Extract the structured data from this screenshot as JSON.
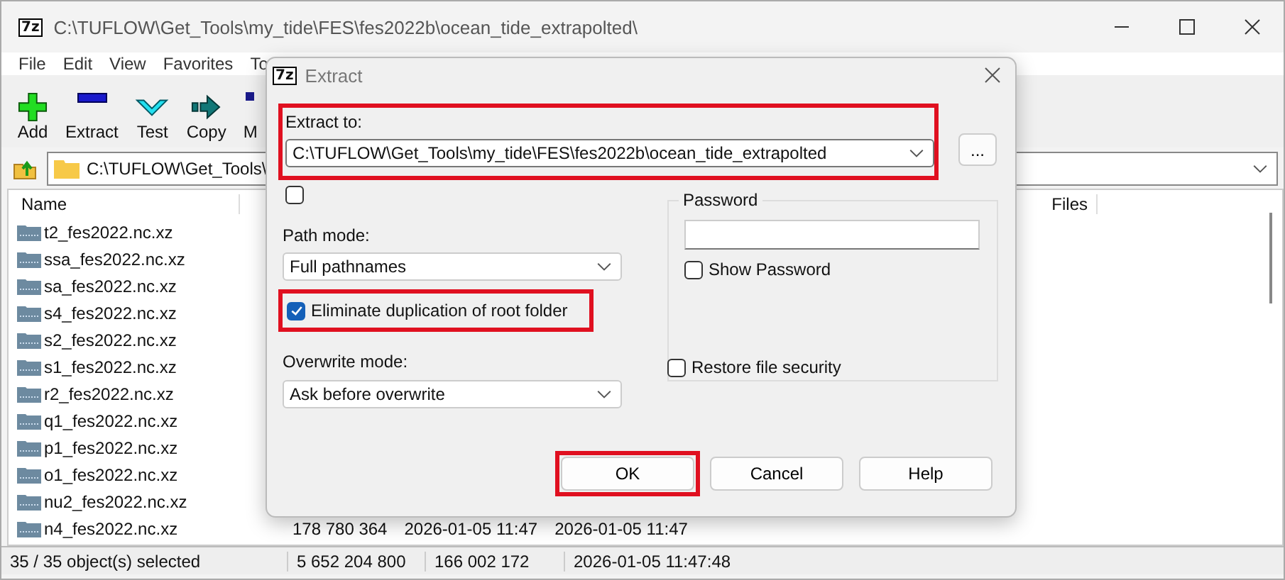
{
  "window": {
    "logo": "7z",
    "title": "C:\\TUFLOW\\Get_Tools\\my_tide\\FES\\fes2022b\\ocean_tide_extrapolted\\"
  },
  "menu": [
    "File",
    "Edit",
    "View",
    "Favorites",
    "To"
  ],
  "toolbar": [
    {
      "label": "Add",
      "kind": "add"
    },
    {
      "label": "Extract",
      "kind": "extract"
    },
    {
      "label": "Test",
      "kind": "test"
    },
    {
      "label": "Copy",
      "kind": "copy"
    },
    {
      "label": "M",
      "kind": "move"
    }
  ],
  "address": "C:\\TUFLOW\\Get_Tools\\",
  "list": {
    "columns": [
      "Name",
      "Files"
    ],
    "rows": [
      {
        "name": "t2_fes2022.nc.xz"
      },
      {
        "name": "ssa_fes2022.nc.xz"
      },
      {
        "name": "sa_fes2022.nc.xz"
      },
      {
        "name": "s4_fes2022.nc.xz"
      },
      {
        "name": "s2_fes2022.nc.xz"
      },
      {
        "name": "s1_fes2022.nc.xz"
      },
      {
        "name": "r2_fes2022.nc.xz"
      },
      {
        "name": "q1_fes2022.nc.xz"
      },
      {
        "name": "p1_fes2022.nc.xz"
      },
      {
        "name": "o1_fes2022.nc.xz"
      },
      {
        "name": "nu2_fes2022.nc.xz"
      },
      {
        "name": "n4_fes2022.nc.xz",
        "cells": [
          "178 780 364",
          "2026-01-05 11:47",
          "2026-01-05 11:47"
        ]
      }
    ]
  },
  "status_bar": [
    "35 / 35 object(s) selected",
    "5 652 204 800",
    "166 002 172",
    "2026-01-05 11:47:48"
  ],
  "dialog": {
    "logo": "7z",
    "title": "Extract",
    "extract_to": {
      "label": "Extract to:",
      "value": "C:\\TUFLOW\\Get_Tools\\my_tide\\FES\\fes2022b\\ocean_tide_extrapolted",
      "highlighted": true
    },
    "browse_button": "...",
    "unlabeled_checkbox": {
      "checked": false
    },
    "path_mode": {
      "label": "Path mode:",
      "value": "Full pathnames"
    },
    "eliminate_duplication": {
      "label": "Eliminate duplication of root folder",
      "checked": true,
      "highlighted": true
    },
    "overwrite_mode": {
      "label": "Overwrite mode:",
      "value": "Ask before overwrite"
    },
    "password": {
      "title": "Password",
      "show_password": {
        "label": "Show Password",
        "checked": false
      }
    },
    "restore_security": {
      "label": "Restore file security",
      "checked": false
    },
    "buttons": [
      {
        "label": "OK",
        "highlighted": true
      },
      {
        "label": "Cancel",
        "highlighted": false
      },
      {
        "label": "Help",
        "highlighted": false
      }
    ]
  }
}
